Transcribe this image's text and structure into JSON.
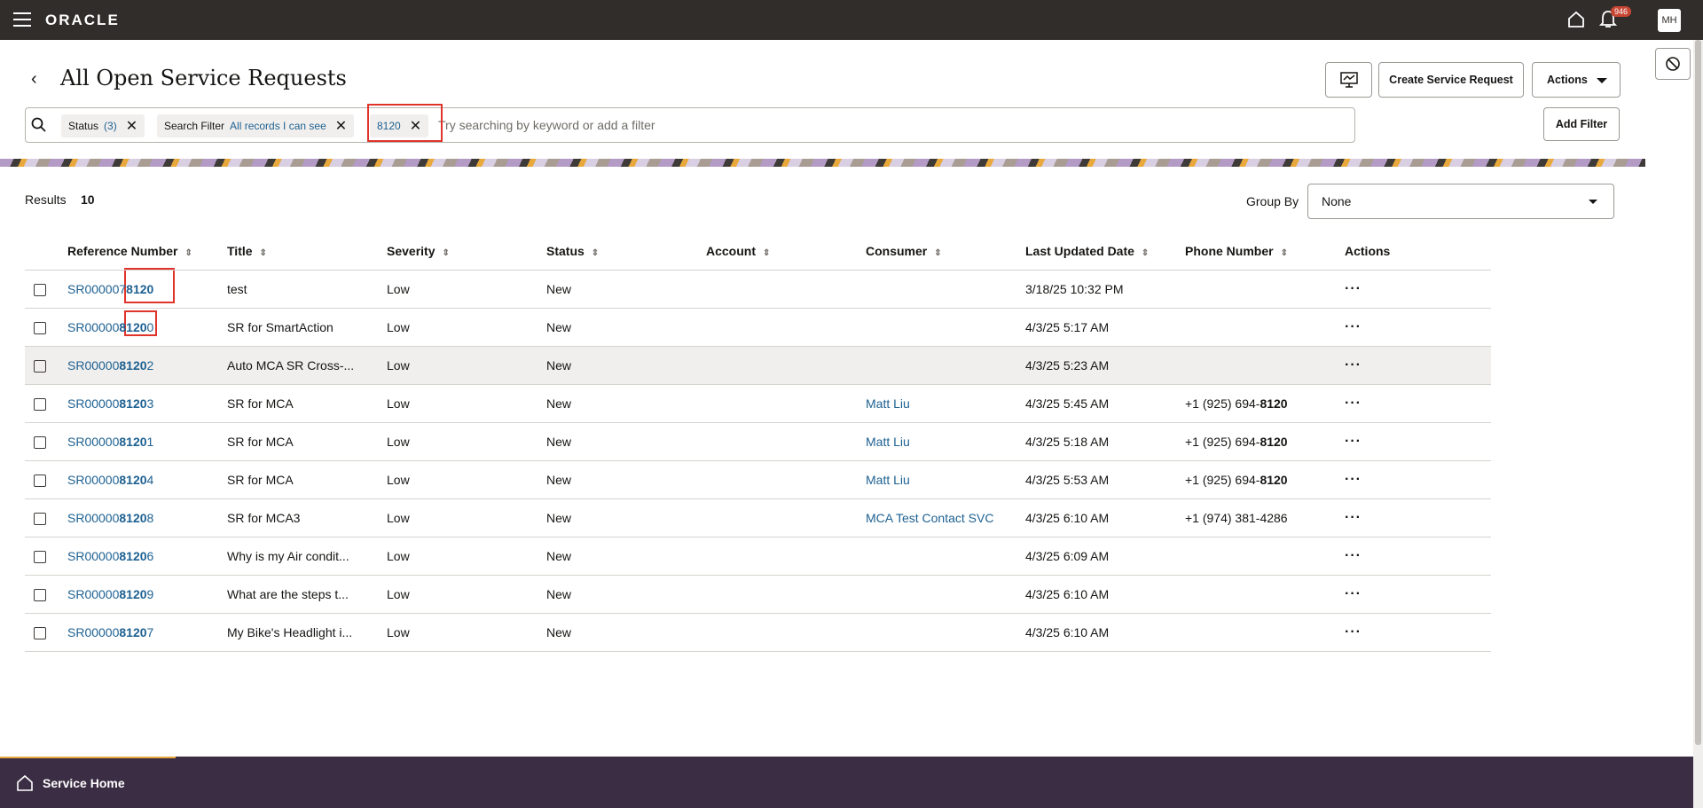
{
  "header": {
    "brand": "ORACLE",
    "notifications_count": "946",
    "avatar_initials": "MH"
  },
  "page": {
    "title": "All Open Service Requests",
    "create_button": "Create Service Request",
    "actions_button": "Actions"
  },
  "search": {
    "chips": [
      {
        "label": "Status",
        "value": "(3)"
      },
      {
        "label": "Search Filter",
        "value": "All records I can see"
      },
      {
        "label": "",
        "value": "8120"
      }
    ],
    "placeholder": "Try searching by keyword or add a filter",
    "add_filter": "Add Filter"
  },
  "results": {
    "label": "Results",
    "count": "10",
    "group_by_label": "Group By",
    "group_by_value": "None"
  },
  "table": {
    "columns": [
      "Reference Number",
      "Title",
      "Severity",
      "Status",
      "Account",
      "Consumer",
      "Last Updated Date",
      "Phone Number",
      "Actions"
    ],
    "rows": [
      {
        "ref_pre": "SR000007",
        "ref_hl": "8120",
        "ref_post": "",
        "title": "test",
        "severity": "Low",
        "status": "New",
        "account": "",
        "consumer": "",
        "updated": "3/18/25 10:32 PM",
        "phone_pre": "",
        "phone_hl": ""
      },
      {
        "ref_pre": "SR00000",
        "ref_hl": "8120",
        "ref_post": "0",
        "title": "SR for SmartAction",
        "severity": "Low",
        "status": "New",
        "account": "",
        "consumer": "",
        "updated": "4/3/25 5:17 AM",
        "phone_pre": "",
        "phone_hl": ""
      },
      {
        "ref_pre": "SR00000",
        "ref_hl": "8120",
        "ref_post": "2",
        "title": "Auto MCA SR Cross-...",
        "severity": "Low",
        "status": "New",
        "account": "",
        "consumer": "",
        "updated": "4/3/25 5:23 AM",
        "phone_pre": "",
        "phone_hl": ""
      },
      {
        "ref_pre": "SR00000",
        "ref_hl": "8120",
        "ref_post": "3",
        "title": "SR for MCA",
        "severity": "Low",
        "status": "New",
        "account": "",
        "consumer": "Matt Liu",
        "updated": "4/3/25 5:45 AM",
        "phone_pre": "+1 (925) 694-",
        "phone_hl": "8120"
      },
      {
        "ref_pre": "SR00000",
        "ref_hl": "8120",
        "ref_post": "1",
        "title": "SR for MCA",
        "severity": "Low",
        "status": "New",
        "account": "",
        "consumer": "Matt Liu",
        "updated": "4/3/25 5:18 AM",
        "phone_pre": "+1 (925) 694-",
        "phone_hl": "8120"
      },
      {
        "ref_pre": "SR00000",
        "ref_hl": "8120",
        "ref_post": "4",
        "title": "SR for MCA",
        "severity": "Low",
        "status": "New",
        "account": "",
        "consumer": "Matt Liu",
        "updated": "4/3/25 5:53 AM",
        "phone_pre": "+1 (925) 694-",
        "phone_hl": "8120"
      },
      {
        "ref_pre": "SR00000",
        "ref_hl": "8120",
        "ref_post": "8",
        "title": "SR for MCA3",
        "severity": "Low",
        "status": "New",
        "account": "",
        "consumer": "MCA Test Contact SVC",
        "updated": "4/3/25 6:10 AM",
        "phone_pre": "+1 (974) 381-4286",
        "phone_hl": ""
      },
      {
        "ref_pre": "SR00000",
        "ref_hl": "8120",
        "ref_post": "6",
        "title": "Why is my Air condit...",
        "severity": "Low",
        "status": "New",
        "account": "",
        "consumer": "",
        "updated": "4/3/25 6:09 AM",
        "phone_pre": "",
        "phone_hl": ""
      },
      {
        "ref_pre": "SR00000",
        "ref_hl": "8120",
        "ref_post": "9",
        "title": "What are the steps t...",
        "severity": "Low",
        "status": "New",
        "account": "",
        "consumer": "",
        "updated": "4/3/25 6:10 AM",
        "phone_pre": "",
        "phone_hl": ""
      },
      {
        "ref_pre": "SR00000",
        "ref_hl": "8120",
        "ref_post": "7",
        "title": "My Bike's Headlight i...",
        "severity": "Low",
        "status": "New",
        "account": "",
        "consumer": "",
        "updated": "4/3/25 6:10 AM",
        "phone_pre": "",
        "phone_hl": ""
      }
    ]
  },
  "footer": {
    "label": "Service Home"
  },
  "colors": {
    "topbar": "#312d2a",
    "link": "#1e6192",
    "footer": "#3b2d44",
    "highlight_box": "#e0342a"
  }
}
